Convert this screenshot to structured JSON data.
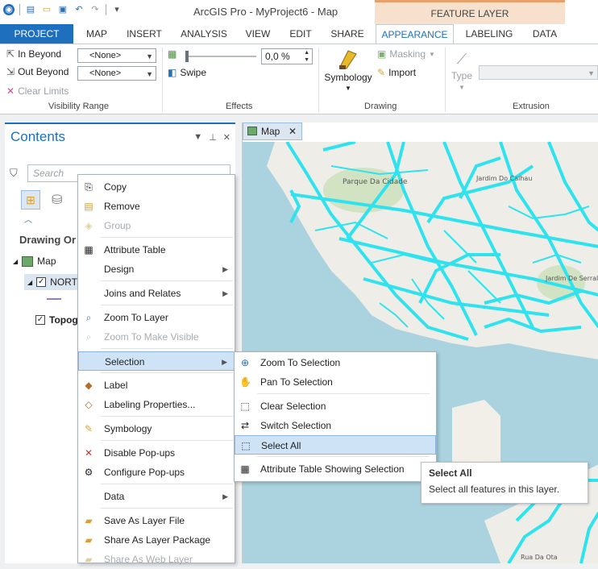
{
  "title_bar": {
    "app_title": "ArcGIS Pro - MyProject6 - Map",
    "contextual_header": "FEATURE LAYER"
  },
  "tabs": [
    {
      "label": "PROJECT"
    },
    {
      "label": "MAP"
    },
    {
      "label": "INSERT"
    },
    {
      "label": "ANALYSIS"
    },
    {
      "label": "VIEW"
    },
    {
      "label": "EDIT"
    },
    {
      "label": "SHARE"
    },
    {
      "label": "APPEARANCE"
    },
    {
      "label": "LABELING"
    },
    {
      "label": "DATA"
    }
  ],
  "ribbon": {
    "visibility": {
      "in_beyond": "In Beyond",
      "out_beyond": "Out Beyond",
      "clear_limits": "Clear Limits",
      "combo1": "<None>",
      "combo2": "<None>",
      "label": "Visibility Range"
    },
    "effects": {
      "transparency": "0,0 %",
      "swipe": "Swipe",
      "label": "Effects"
    },
    "drawing": {
      "symbology": "Symbology",
      "masking": "Masking",
      "import": "Import",
      "label": "Drawing"
    },
    "extrusion": {
      "type": "Type",
      "label": "Extrusion"
    }
  },
  "contents": {
    "title": "Contents",
    "search_placeholder": "Search",
    "drawing_order": "Drawing Or",
    "map_label": "Map",
    "layer1": "NORT",
    "layer2": "Topog"
  },
  "map": {
    "tab_label": "Map",
    "place_labels": [
      "Parque Da Cidade",
      "Jardim Do Calhau",
      "Jardim De Serralves",
      "Rua Da Ota"
    ]
  },
  "context_menu": {
    "items": [
      {
        "label": "Copy"
      },
      {
        "label": "Remove"
      },
      {
        "label": "Group"
      },
      {
        "label": "Attribute Table"
      },
      {
        "label": "Design"
      },
      {
        "label": "Joins and Relates"
      },
      {
        "label": "Zoom To Layer"
      },
      {
        "label": "Zoom To Make Visible"
      },
      {
        "label": "Selection"
      },
      {
        "label": "Label"
      },
      {
        "label": "Labeling Properties..."
      },
      {
        "label": "Symbology"
      },
      {
        "label": "Disable Pop-ups"
      },
      {
        "label": "Configure Pop-ups"
      },
      {
        "label": "Data"
      },
      {
        "label": "Save As Layer File"
      },
      {
        "label": "Share As Layer Package"
      },
      {
        "label": "Share As Web Layer"
      }
    ]
  },
  "selection_submenu": {
    "items": [
      {
        "label": "Zoom To Selection"
      },
      {
        "label": "Pan To Selection"
      },
      {
        "label": "Clear Selection"
      },
      {
        "label": "Switch Selection"
      },
      {
        "label": "Select All"
      },
      {
        "label": "Attribute Table Showing Selection"
      }
    ]
  },
  "tooltip": {
    "title": "Select All",
    "description": "Select all features in this layer."
  },
  "colors": {
    "accent": "#1f6fbf",
    "road": "#2fe3ee",
    "water": "#aad3df",
    "land": "#efede8"
  }
}
